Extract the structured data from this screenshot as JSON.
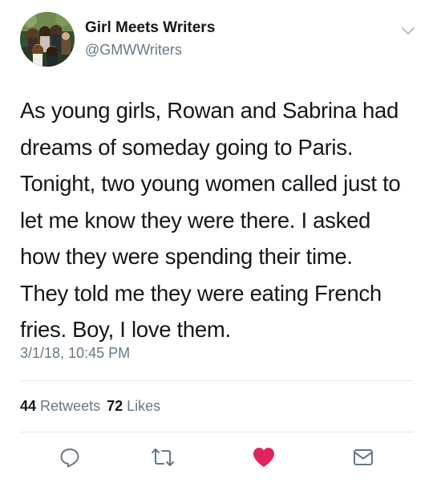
{
  "author": {
    "display_name": "Girl Meets Writers",
    "handle": "@GMWWriters"
  },
  "tweet": {
    "text": "As young girls, Rowan and Sabrina had\ndreams of someday going to Paris.\nTonight, two young women called just to\nlet me know they were there. I asked\nhow they were spending their time.\nThey told me they were eating French\nfries. Boy,   I love them.",
    "timestamp": "3/1/18, 10:45 PM"
  },
  "stats": {
    "retweets_count": "44",
    "retweets_label": "Retweets",
    "likes_count": "72",
    "likes_label": "Likes"
  },
  "actions": {
    "reply_icon": "reply-icon",
    "retweet_icon": "retweet-icon",
    "like_icon": "heart-icon",
    "like_state": "liked",
    "like_color": "#e0245e",
    "dm_icon": "envelope-icon"
  },
  "colors": {
    "text_primary": "#14171a",
    "text_secondary": "#657786",
    "divider": "#e1e8ed",
    "icon_gray": "#657786"
  }
}
